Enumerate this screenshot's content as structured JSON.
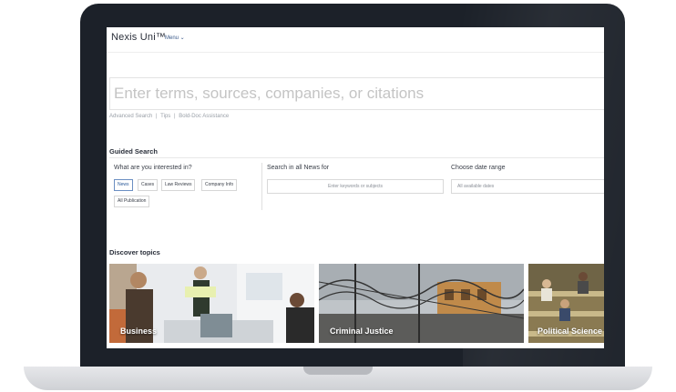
{
  "header": {
    "logo": "Nexis Uni™",
    "menu_label": "Menu ⌄"
  },
  "search": {
    "placeholder": "Enter terms, sources, companies, or citations",
    "links": [
      "Advanced Search",
      "|",
      "Tips",
      "|",
      "Bold-Doc Assistance"
    ]
  },
  "guided": {
    "title": "Guided Search",
    "interest_label": "What are you interested in?",
    "chips": [
      "News",
      "Cases",
      "Law Reviews",
      "Company Info",
      "All Publication"
    ],
    "search_label": "Search in all News for",
    "search_placeholder": "Enter keywords or subjects",
    "date_label": "Choose date range",
    "date_value": "All available dates"
  },
  "topics": {
    "title": "Discover topics",
    "tiles": [
      "Business",
      "Criminal Justice",
      "Political Science"
    ]
  },
  "colors": {
    "frame": "#1c2129",
    "accent": "#2b5a9a"
  }
}
